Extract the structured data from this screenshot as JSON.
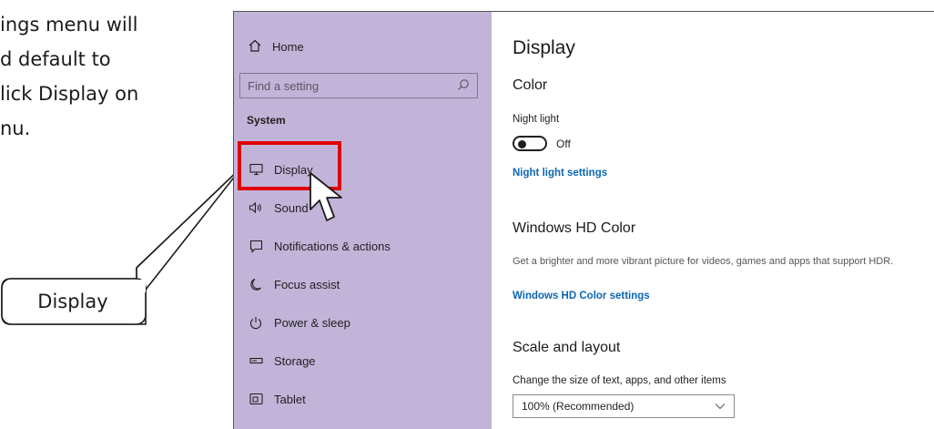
{
  "intro": {
    "lines": [
      "ings menu will",
      "d default to",
      "lick Display on",
      "nu."
    ]
  },
  "callout": {
    "label": "Display"
  },
  "sidebar": {
    "home": "Home",
    "search_placeholder": "Find a setting",
    "section": "System",
    "items": [
      {
        "label": "Display",
        "icon": "monitor-icon"
      },
      {
        "label": "Sound",
        "icon": "speaker-icon"
      },
      {
        "label": "Notifications & actions",
        "icon": "notification-icon"
      },
      {
        "label": "Focus assist",
        "icon": "moon-icon"
      },
      {
        "label": "Power & sleep",
        "icon": "power-icon"
      },
      {
        "label": "Storage",
        "icon": "storage-icon"
      },
      {
        "label": "Tablet",
        "icon": "tablet-icon"
      }
    ]
  },
  "content": {
    "title": "Display",
    "color": {
      "heading": "Color",
      "night_light_label": "Night light",
      "toggle_state": "Off",
      "settings_link": "Night light settings"
    },
    "hd_color": {
      "heading": "Windows HD Color",
      "description": "Get a brighter and more vibrant picture for videos, games and apps that support HDR.",
      "settings_link": "Windows HD Color settings"
    },
    "scale": {
      "heading": "Scale and layout",
      "label": "Change the size of text, apps, and other items",
      "selected": "100% (Recommended)"
    }
  },
  "colors": {
    "sidebar_bg": "#c2b4d8",
    "link": "#0b66b3",
    "highlight": "#e00000"
  }
}
